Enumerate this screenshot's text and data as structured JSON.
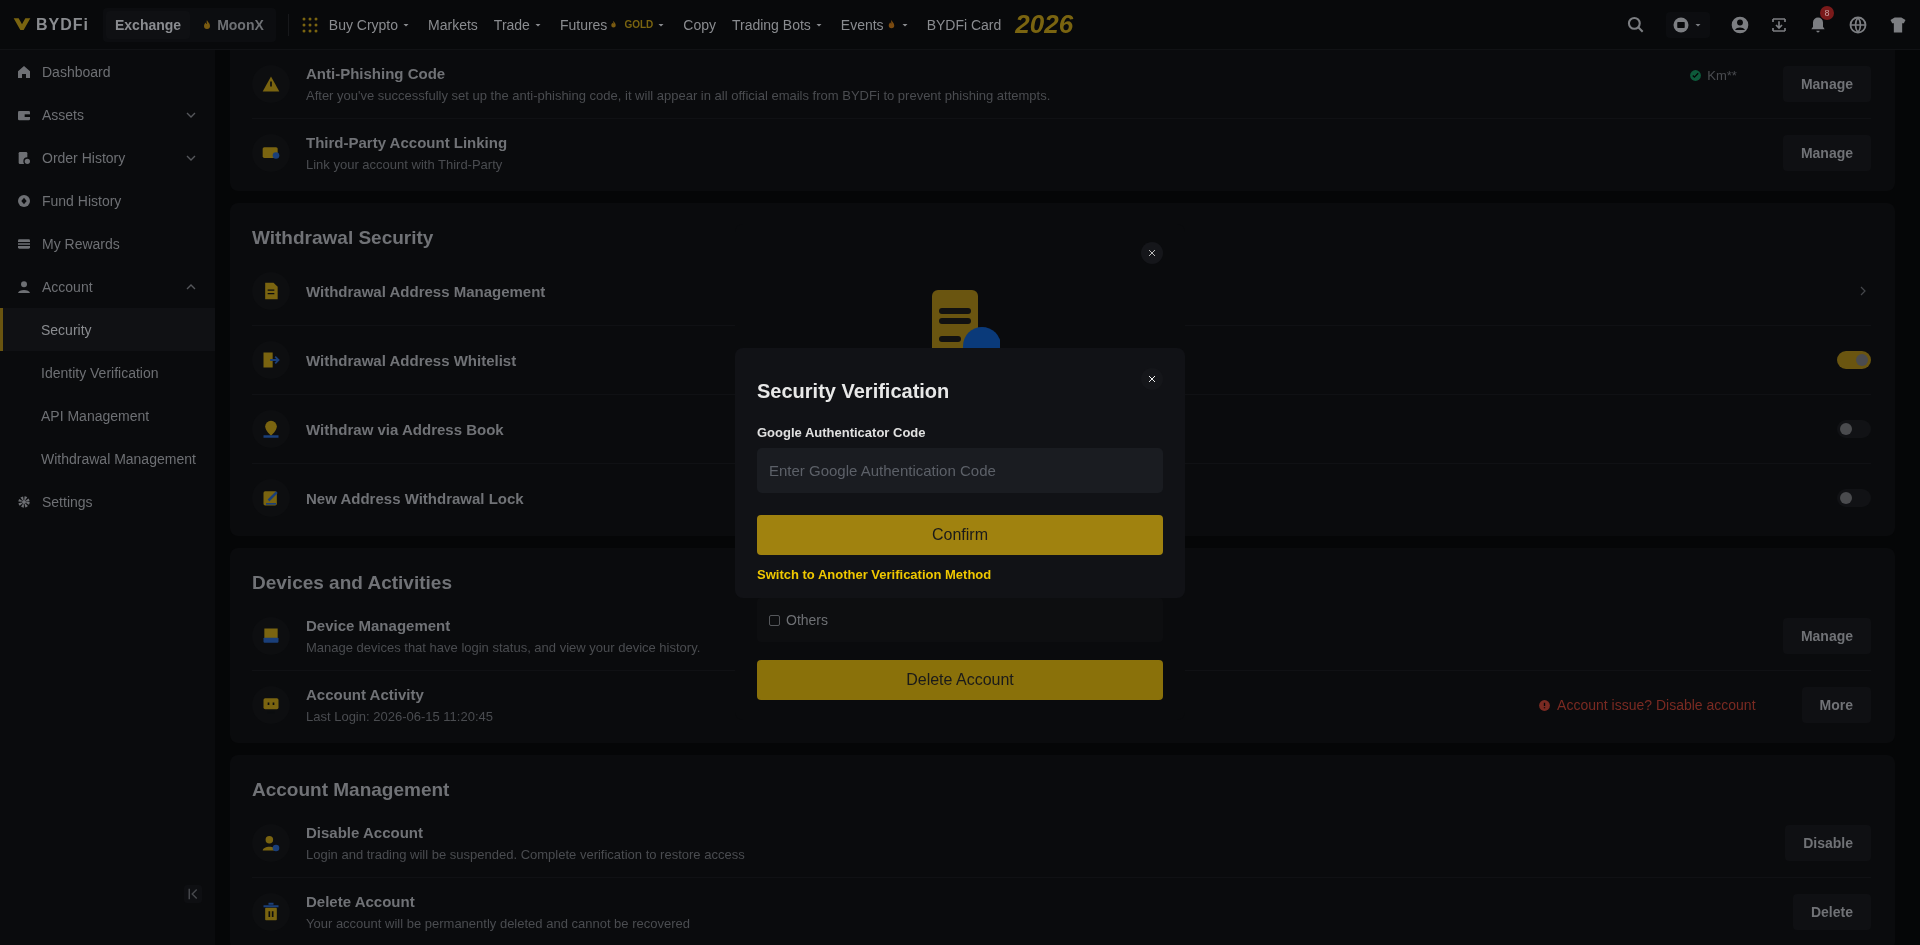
{
  "nav": {
    "logo": "BYDFi",
    "tabs": [
      {
        "label": "Exchange",
        "selected": true
      },
      {
        "label": "MoonX",
        "selected": false
      }
    ],
    "menu": [
      {
        "label": "Buy Crypto",
        "dropdown": true
      },
      {
        "label": "Markets",
        "dropdown": false
      },
      {
        "label": "Trade",
        "dropdown": true
      },
      {
        "label": "Futures",
        "badge": "GOLD",
        "dropdown": true
      },
      {
        "label": "Copy",
        "dropdown": false
      },
      {
        "label": "Trading Bots",
        "dropdown": true
      },
      {
        "label": "Events",
        "flame": true,
        "dropdown": true
      },
      {
        "label": "BYDFi Card",
        "dropdown": false
      }
    ],
    "promo": "2026",
    "notification_count": "8"
  },
  "sidebar": {
    "items": [
      {
        "label": "Dashboard",
        "selected": false
      },
      {
        "label": "Assets",
        "expanded": false,
        "selected": false
      },
      {
        "label": "Order History",
        "expanded": false,
        "selected": false
      },
      {
        "label": "Fund History",
        "selected": false
      },
      {
        "label": "My Rewards",
        "selected": false
      },
      {
        "label": "Account",
        "expanded": true,
        "selected": false,
        "children": [
          {
            "label": "Security",
            "selected": true
          },
          {
            "label": "Identity Verification",
            "selected": false
          },
          {
            "label": "API Management",
            "selected": false
          },
          {
            "label": "Withdrawal Management",
            "selected": false
          }
        ]
      },
      {
        "label": "Settings",
        "selected": false
      }
    ]
  },
  "sections": [
    {
      "rows": [
        {
          "title": "Anti-Phishing Code",
          "description": "After you've successfully set up the anti-phishing code, it will appear in all official emails from BYDFi to prevent phishing attempts.",
          "kind": "button",
          "status": "Km**",
          "action": "Manage"
        },
        {
          "title": "Third-Party Account Linking",
          "description": "Link your account with Third-Party",
          "kind": "button",
          "action": "Manage"
        }
      ]
    },
    {
      "title": "Withdrawal Security",
      "rows": [
        {
          "title": "Withdrawal Address Management",
          "kind": "chevron"
        },
        {
          "title": "Withdrawal Address Whitelist",
          "kind": "toggle",
          "on": true
        },
        {
          "title": "Withdraw via Address Book",
          "kind": "toggle",
          "on": false
        },
        {
          "title": "New Address Withdrawal Lock",
          "kind": "toggle",
          "on": false
        }
      ]
    },
    {
      "title": "Devices and Activities",
      "rows": [
        {
          "title": "Device Management",
          "description": "Manage devices that have login status, and view your device history.",
          "kind": "button",
          "action": "Manage"
        },
        {
          "title": "Account Activity",
          "description": "Last Login: 2026-06-15 11:20:45",
          "kind": "button",
          "warning": "Account issue? Disable account",
          "action": "More"
        }
      ]
    },
    {
      "title": "Account Management",
      "rows": [
        {
          "title": "Disable Account",
          "description": "Login and trading will be suspended. Complete verification to restore access",
          "kind": "button",
          "action": "Disable"
        },
        {
          "title": "Delete Account",
          "description": "Your account will be permanently deleted and cannot be recovered",
          "kind": "button",
          "action": "Delete"
        }
      ]
    }
  ],
  "modals": [
    {
      "kind": "verify",
      "title": "Security Verification",
      "field_label": "Google Authenticator Code",
      "placeholder": "Enter Google Authentication Code",
      "button": "Confirm",
      "link": "Switch to Another Verification Method"
    },
    {
      "kind": "delete",
      "checkbox": {
        "label": "Others",
        "checked": false
      },
      "button": "Delete Account"
    }
  ]
}
